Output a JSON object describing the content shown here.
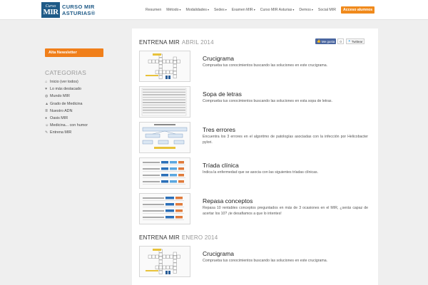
{
  "header": {
    "logo": {
      "line1": "Curso",
      "line2": "MIR",
      "text_line1": "CURSO MIR",
      "text_line2": "ASTURIAS®"
    },
    "nav": [
      {
        "label": "Resumen",
        "dropdown": false
      },
      {
        "label": "Método",
        "dropdown": true
      },
      {
        "label": "Modalidades",
        "dropdown": true
      },
      {
        "label": "Sedes",
        "dropdown": true
      },
      {
        "label": "Examen MIR",
        "dropdown": true
      },
      {
        "label": "Curso MIR Asturias",
        "dropdown": true
      },
      {
        "label": "Demos",
        "dropdown": true
      },
      {
        "label": "Social MIR",
        "dropdown": false
      }
    ],
    "cta": "Acceso alumnos"
  },
  "sidebar": {
    "newsletter": "Alta Newsletter",
    "categories_title": "CATEGORIAS",
    "categories": [
      {
        "icon": "home-icon",
        "glyph": "⌂",
        "label": "Inicio (ver todos)"
      },
      {
        "icon": "heart-icon",
        "glyph": "♥",
        "label": "Lo más destacado"
      },
      {
        "icon": "globe-icon",
        "glyph": "◍",
        "label": "Mundo MIR"
      },
      {
        "icon": "graduation-icon",
        "glyph": "▲",
        "label": "Grado de Medicina"
      },
      {
        "icon": "dna-icon",
        "glyph": "≣",
        "label": "Nuestro ADN"
      },
      {
        "icon": "chat-icon",
        "glyph": "●",
        "label": "Oasis MIR"
      },
      {
        "icon": "smile-icon",
        "glyph": "☺",
        "label": "Medicina... con humor"
      },
      {
        "icon": "pencil-icon",
        "glyph": "✎",
        "label": "Entrena MIR"
      }
    ]
  },
  "main": {
    "sections": [
      {
        "title": "ENTRENA MIR",
        "subtitle": "ABRIL 2014",
        "entries": [
          {
            "thumb": "crossword",
            "title": "Crucigrama",
            "desc": "Comprueba tus conocimientos buscando las soluciones en este crucigrama."
          },
          {
            "thumb": "wordsearch",
            "title": "Sopa de letras",
            "desc": "Comprueba tus conocimientos buscando las soluciones en esta sopa de letras."
          },
          {
            "thumb": "errors",
            "title": "Tres errores",
            "desc": "Encuentra los 3 errores en el algoritmo de patologías asociadas con la infección por Helicobacter pylori."
          },
          {
            "thumb": "triads",
            "title": "Tríada clínica",
            "desc": "Indica la enfermedad que se asocia con las siguientes tríadas clínicas."
          },
          {
            "thumb": "review",
            "title": "Repasa conceptos",
            "desc": "Repasa 10 rentables conceptos preguntados en más de 3 ocasiones en el MIR, ¿serás capaz de acertar los 10? ¡te desafiamos a que lo intentes!"
          }
        ]
      },
      {
        "title": "ENTRENA MIR",
        "subtitle": "ENERO 2014",
        "entries": [
          {
            "thumb": "crossword",
            "title": "Crucigrama",
            "desc": "Comprueba tus conocimientos buscando las soluciones en este crucigrama."
          }
        ]
      }
    ],
    "social": {
      "fb_label": "Me gusta",
      "fb_count": "0",
      "tw_label": "Twittear"
    }
  },
  "colors": {
    "brand_blue": "#1e5a87",
    "accent_orange": "#f07f1a",
    "facebook_blue": "#4a66a0"
  }
}
